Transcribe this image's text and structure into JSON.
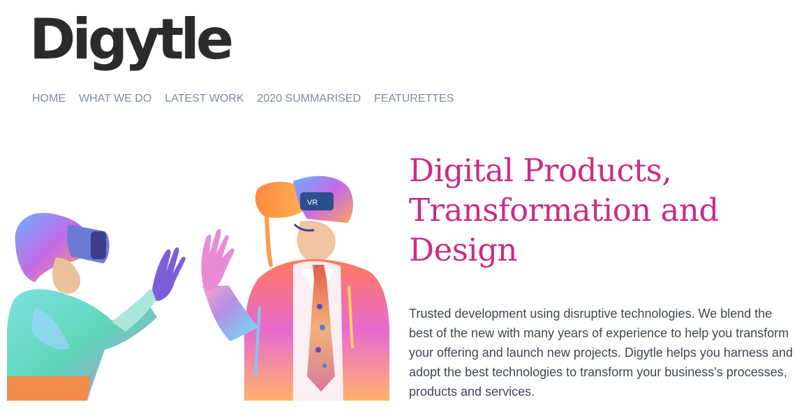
{
  "brand": {
    "logo_text": "Digytle"
  },
  "nav": {
    "items": [
      {
        "label": "HOME"
      },
      {
        "label": "WHAT WE DO"
      },
      {
        "label": "LATEST WORK"
      },
      {
        "label": "2020 SUMMARISED"
      },
      {
        "label": "FEATURETTES"
      }
    ]
  },
  "hero": {
    "image_icon": "vr-people-illustration",
    "headline": "Digital Products, Transformation and Design",
    "intro": "Trusted development using disruptive technologies. We blend the best of the new with many years of experience to help you transform your offering and launch new projects. Digytle helps you harness and adopt the best technologies to transform your business's processes, products and services."
  },
  "colors": {
    "headline": "#cc2b87",
    "nav": "#7f8aa0",
    "logo": "#2b2b2b",
    "body_text": "#404654"
  }
}
